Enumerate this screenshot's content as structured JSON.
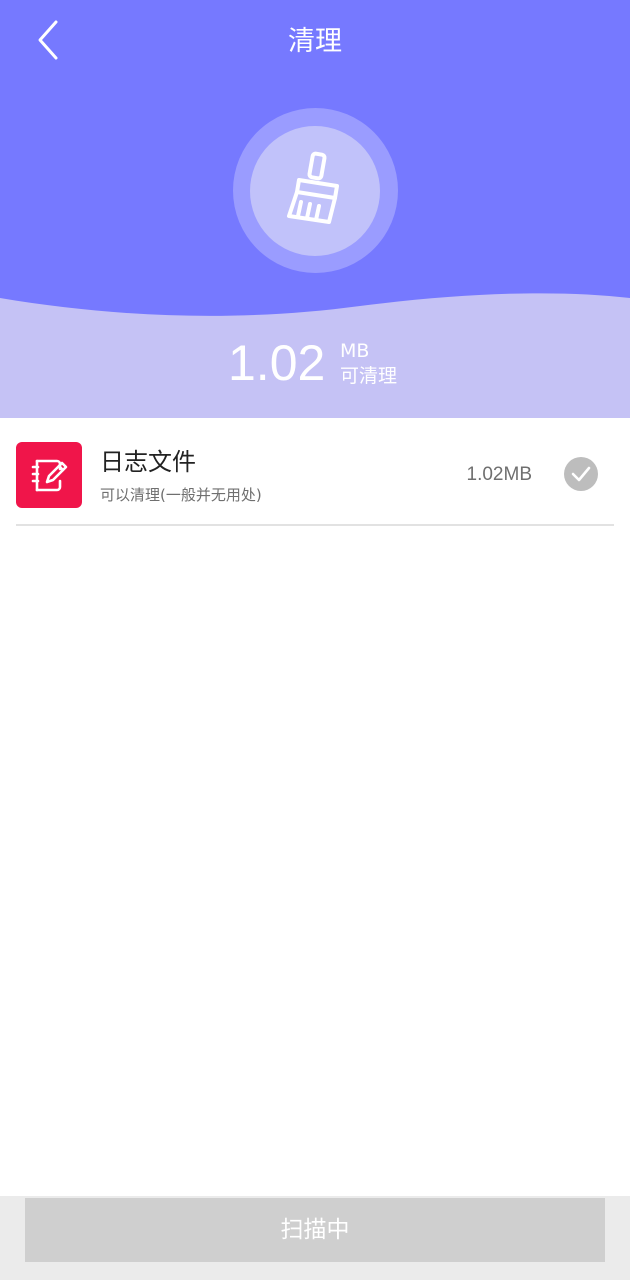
{
  "header": {
    "title": "清理",
    "back_icon": "chevron-left-icon",
    "center_icon": "broom-icon",
    "colors": {
      "top": "#7679ff",
      "wave": "#c5c2f5"
    }
  },
  "summary": {
    "size_value": "1.02",
    "size_unit": "MB",
    "caption": "可清理"
  },
  "items": [
    {
      "icon": "edit-note-icon",
      "icon_color": "#f0154a",
      "title": "日志文件",
      "subtitle": "可以清理(一般并无用处)",
      "size": "1.02MB",
      "checked": true
    }
  ],
  "footer": {
    "button_label": "扫描中"
  }
}
